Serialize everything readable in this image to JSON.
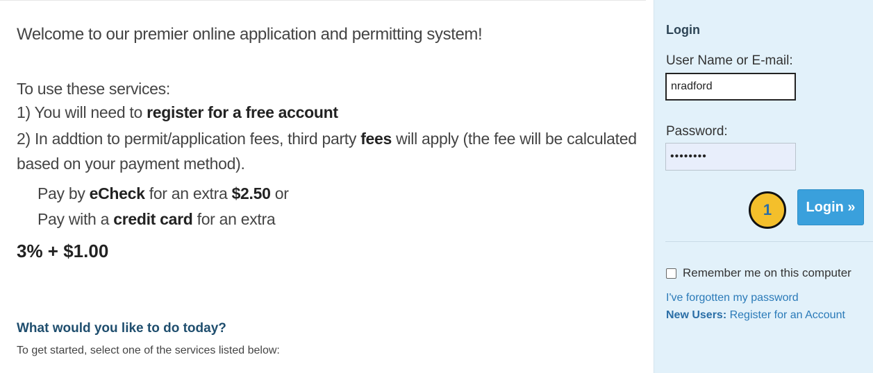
{
  "main": {
    "welcome": "Welcome to our premier online application and permitting system!",
    "use_services": "To use these services:",
    "item1_prefix": "1) You will need to ",
    "item1_bold": "register for a free account",
    "item2_prefix": "2) In addtion to permit/application fees, third party ",
    "item2_bold": "fees",
    "item2_suffix": " will apply (the fee will be calculated",
    "item2_cont": "based on your payment method).",
    "echeck_prefix": "Pay by ",
    "echeck_bold": "eCheck",
    "echeck_mid": " for an extra ",
    "echeck_amount": "$2.50",
    "echeck_suffix": " or",
    "cc_prefix": "Pay with a ",
    "cc_bold": "credit card",
    "cc_suffix": " for an extra",
    "cc_fee": "3% + $1.00",
    "question": "What would you like to do today?",
    "get_started": "To get started, select one of the services listed below:"
  },
  "login": {
    "title": "Login",
    "username_label": "User Name or E-mail:",
    "username_value": "nradford",
    "password_label": "Password:",
    "password_value": "••••••••",
    "login_button": "Login »",
    "step_badge": "1",
    "remember_label": "Remember me on this computer",
    "forgot_link": "I've forgotten my password",
    "new_users_bold": "New Users:",
    "register_link": " Register for an Account"
  },
  "colors": {
    "sidebar_bg": "#e2f1fa",
    "button_blue": "#3aa0dc",
    "link_blue": "#2a7ab8",
    "badge_yellow": "#f4bf2b",
    "heading_navy": "#1f4e6e"
  }
}
